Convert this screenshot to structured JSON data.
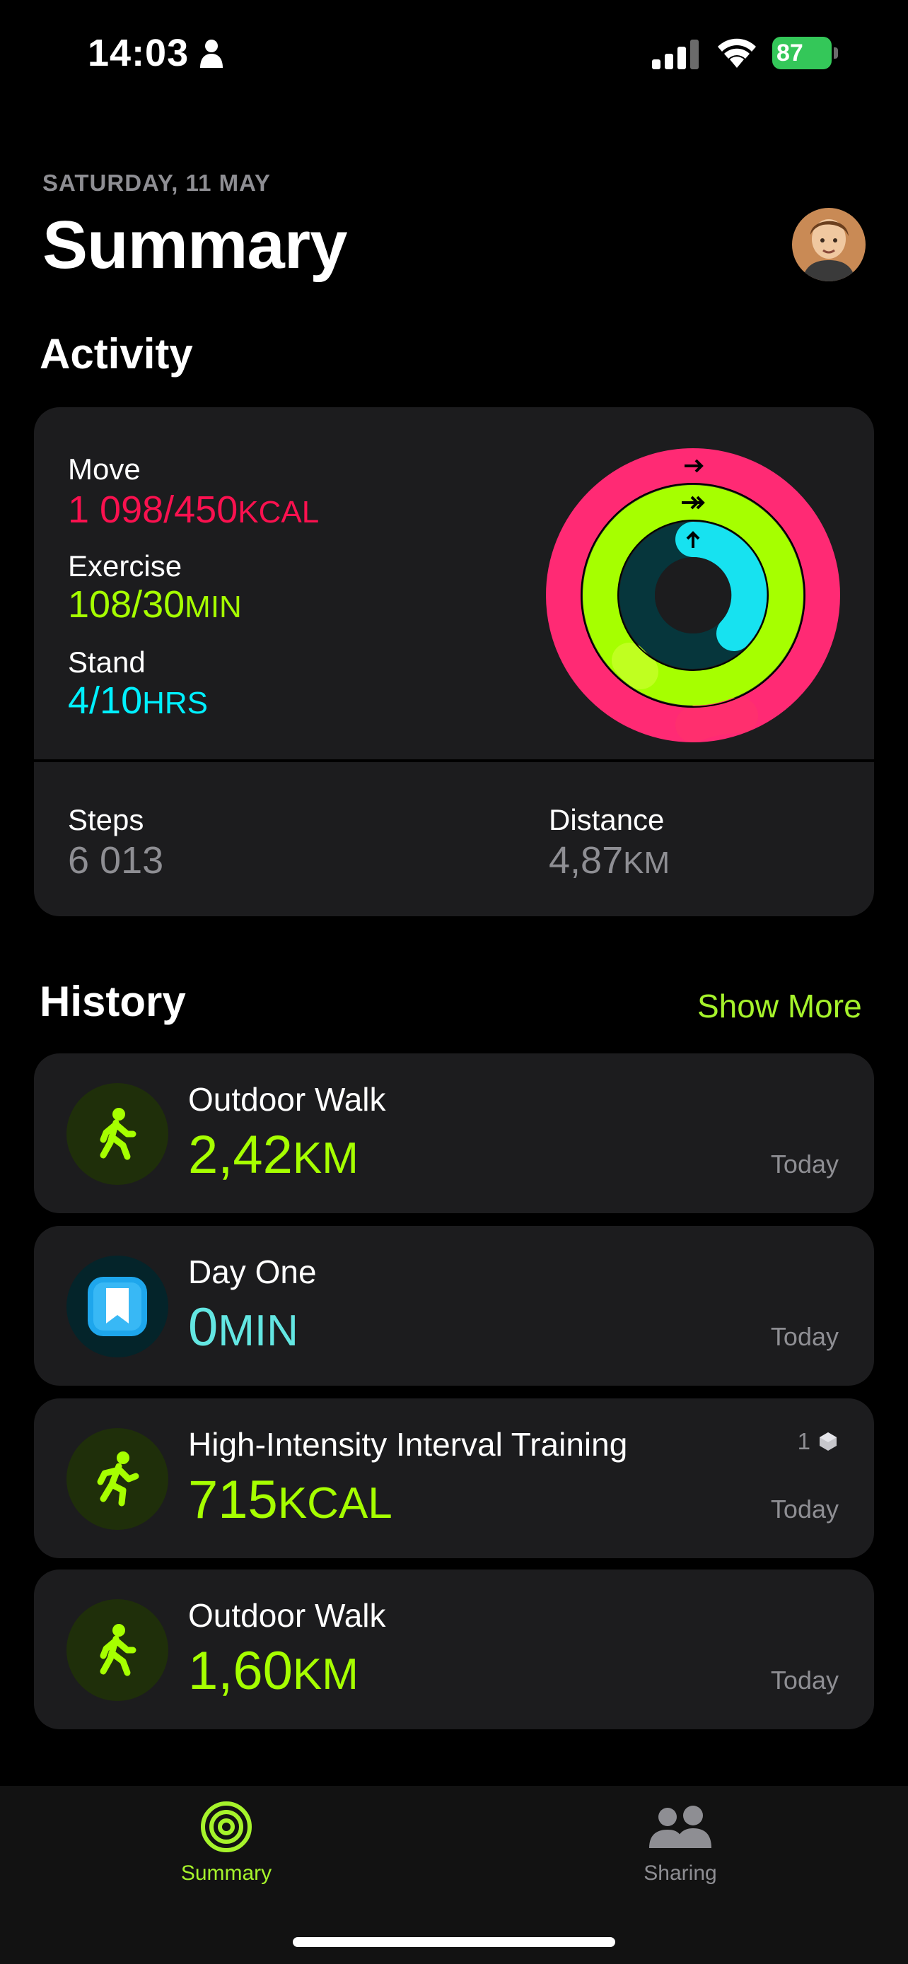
{
  "status_bar": {
    "time": "14:03",
    "battery": "87"
  },
  "header": {
    "date": "SATURDAY, 11 MAY",
    "title": "Summary"
  },
  "activity": {
    "heading": "Activity",
    "move": {
      "label": "Move",
      "value": "1 098/450",
      "unit": "KCAL",
      "progress": 2.44,
      "color": "#fa114f"
    },
    "exercise": {
      "label": "Exercise",
      "value": "108/30",
      "unit": "MIN",
      "progress": 3.6,
      "color": "#a6ff00"
    },
    "stand": {
      "label": "Stand",
      "value": "4/10",
      "unit": "HRS",
      "progress": 0.4,
      "color": "#00f0ff"
    },
    "steps": {
      "label": "Steps",
      "value": "6 013"
    },
    "distance": {
      "label": "Distance",
      "value": "4,87",
      "unit": "KM"
    }
  },
  "history": {
    "heading": "History",
    "show_more": "Show More",
    "items": [
      {
        "icon": "walk-icon",
        "title": "Outdoor Walk",
        "value": "2,42",
        "unit": "KM",
        "date": "Today"
      },
      {
        "icon": "bookmark-icon",
        "title": "Day One",
        "value": "0",
        "unit": "MIN",
        "date": "Today"
      },
      {
        "icon": "running-icon",
        "title": "High-Intensity Interval Training",
        "value": "715",
        "unit": "KCAL",
        "date": "Today",
        "badge": "1"
      },
      {
        "icon": "walk-icon",
        "title": "Outdoor Walk",
        "value": "1,60",
        "unit": "KM",
        "date": "Today"
      }
    ]
  },
  "tabs": {
    "summary": "Summary",
    "sharing": "Sharing"
  },
  "colors": {
    "accent": "#a6f32b",
    "move": "#fa114f",
    "exercise": "#a6ff00",
    "stand": "#00f0ff"
  }
}
